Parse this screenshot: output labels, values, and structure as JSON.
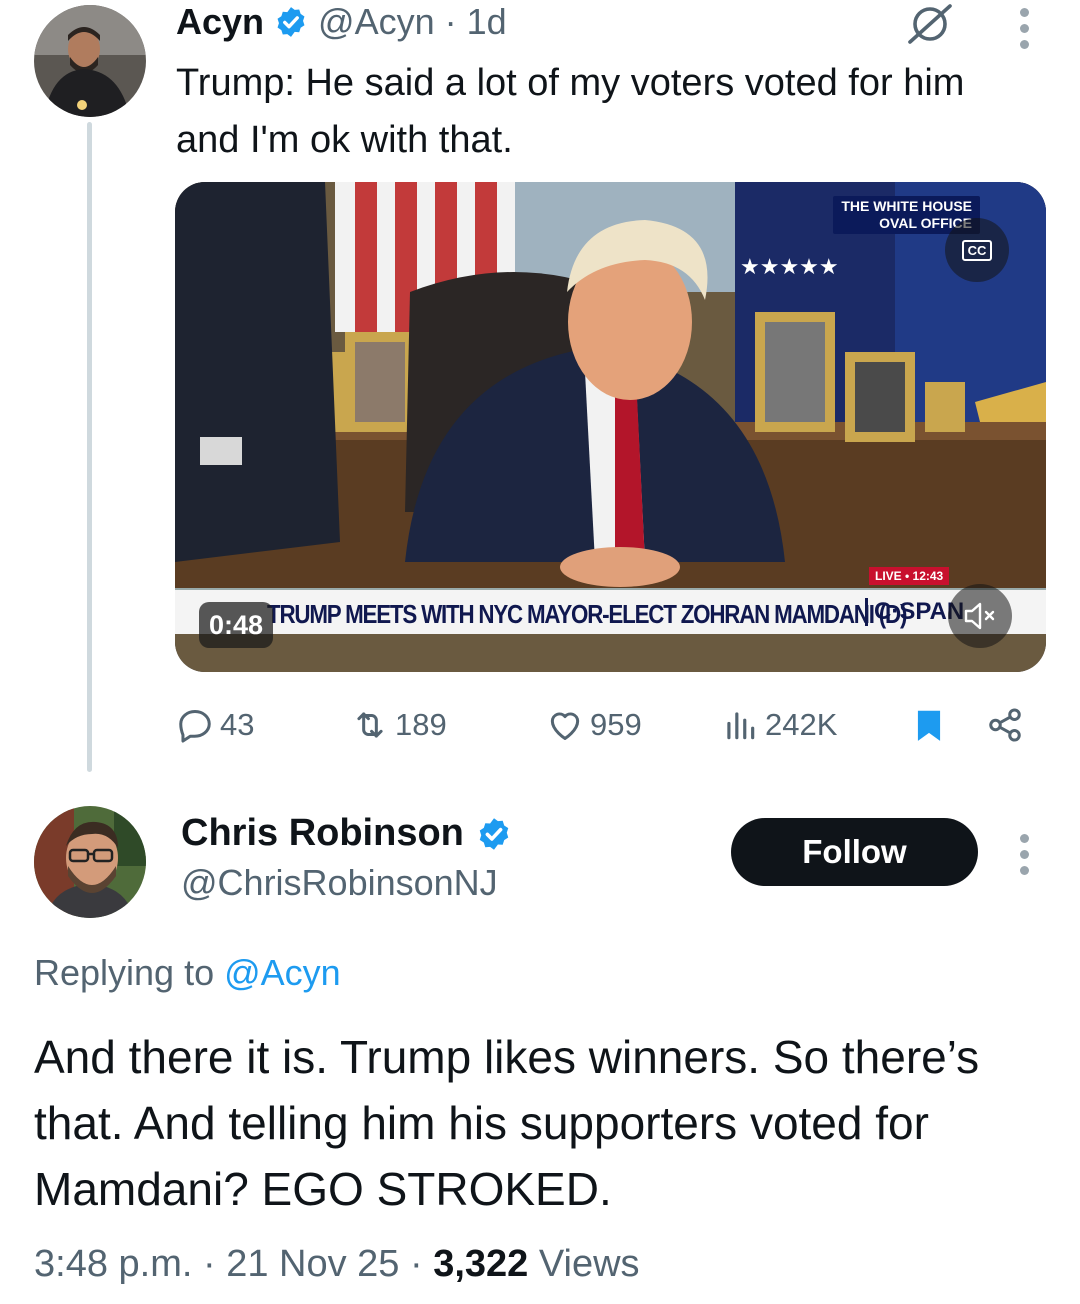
{
  "tweet": {
    "display_name": "Acyn",
    "handle": "@Acyn",
    "time": "1d",
    "separator": "·",
    "text": "Trump: He said a lot of my voters voted for him and I'm ok with that.",
    "media": {
      "duration": "0:48",
      "cc_label": "CC",
      "overlay_top_line1": "THE WHITE HOUSE",
      "overlay_top_line2": "OVAL OFFICE",
      "live_label": "LIVE • 12:43",
      "chyron": "TRUMP MEETS WITH NYC MAYOR-ELECT ZOHRAN MAMDANI (D)",
      "network": "C·SPAN"
    },
    "stats": {
      "replies": "43",
      "reposts": "189",
      "likes": "959",
      "views": "242K"
    }
  },
  "reply": {
    "display_name": "Chris Robinson",
    "handle": "@ChrisRobinsonNJ",
    "follow_label": "Follow",
    "replying_prefix": "Replying to",
    "replying_to": "@Acyn",
    "text": "And there it is. Trump likes winners. So there’s that. And telling him his supporters voted for Mamdani? EGO STROKED.",
    "time": "3:48 p.m.",
    "date": "21 Nov 25",
    "views_count": "3,322",
    "views_label": "Views",
    "sep": "·"
  },
  "colors": {
    "accent": "#1d9bf0",
    "text_primary": "#0f1419",
    "text_secondary": "#536471",
    "bookmark_active": "#1d9bf0"
  }
}
